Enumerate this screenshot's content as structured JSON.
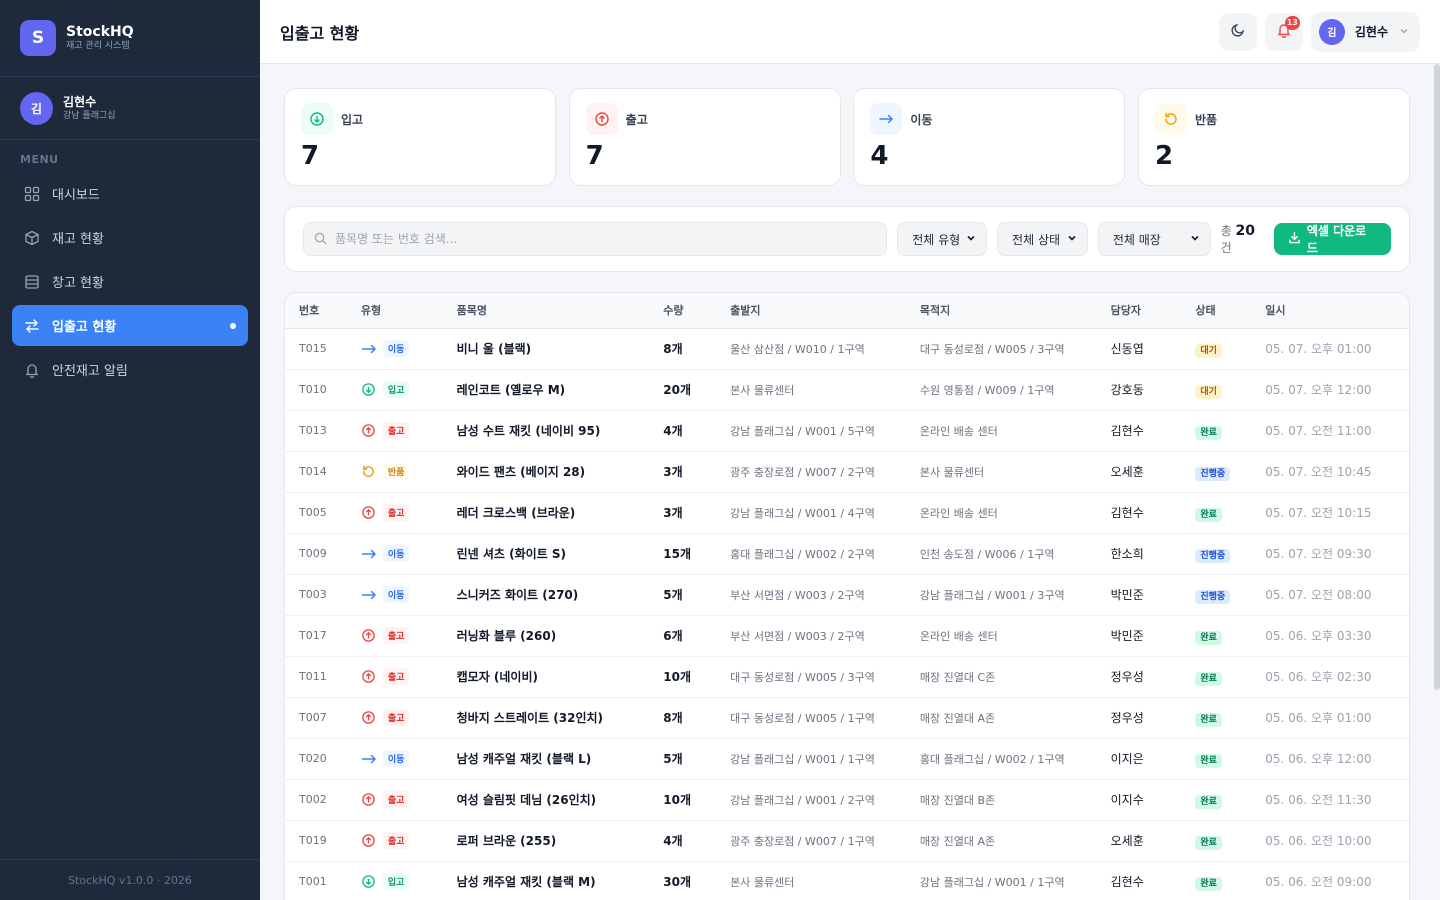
{
  "app": {
    "brand": "StockHQ",
    "brand_subtitle": "재고 관리 시스템",
    "logo_letter": "S",
    "footer": "StockHQ v1.0.0 · 2026"
  },
  "user": {
    "avatar_letter": "김",
    "name": "김현수",
    "store": "강남 플래그십"
  },
  "sidebar": {
    "menu_label": "MENU",
    "items": [
      {
        "label": "대시보드",
        "icon": "dashboard-icon"
      },
      {
        "label": "재고 현황",
        "icon": "box-icon"
      },
      {
        "label": "창고 현황",
        "icon": "warehouse-icon"
      },
      {
        "label": "입출고 현황",
        "icon": "transfer-icon",
        "active": true
      },
      {
        "label": "안전재고 알림",
        "icon": "bell-icon"
      }
    ]
  },
  "header": {
    "title": "입출고 현황",
    "notification_count": "13",
    "user_name": "김현수"
  },
  "stats": [
    {
      "label": "입고",
      "value": "7",
      "icon": "arrow-down-circle-icon",
      "color": "#10b981",
      "bg": "#ecfdf5"
    },
    {
      "label": "출고",
      "value": "7",
      "icon": "arrow-up-circle-icon",
      "color": "#ef4444",
      "bg": "#fef2f2"
    },
    {
      "label": "이동",
      "value": "4",
      "icon": "arrow-right-icon",
      "color": "#3b82f6",
      "bg": "#eff6ff"
    },
    {
      "label": "반품",
      "value": "2",
      "icon": "rotate-icon",
      "color": "#f59e0b",
      "bg": "#fffbeb"
    }
  ],
  "filters": {
    "search_placeholder": "품목명 또는 번호 검색...",
    "type_select": "전체 유형",
    "status_select": "전체 상태",
    "store_select": "전체 매장",
    "total_prefix": "총",
    "total_count": "20",
    "total_suffix": "건",
    "excel_button": "엑셀 다운로드"
  },
  "table": {
    "columns": [
      "번호",
      "유형",
      "품목명",
      "수량",
      "출발지",
      "목적지",
      "담당자",
      "상태",
      "일시"
    ],
    "rows": [
      {
        "id": "T015",
        "type": "이동",
        "kind": "move",
        "name": "비니 울 (블랙)",
        "qty": "8개",
        "from": "울산 삼산점 / W010 / 1구역",
        "to": "대구 동성로점 / W005 / 3구역",
        "manager": "신동엽",
        "status": "대기",
        "status_kind": "wait",
        "date": "05. 07. 오후 01:00"
      },
      {
        "id": "T010",
        "type": "입고",
        "kind": "in",
        "name": "레인코트 (옐로우 M)",
        "qty": "20개",
        "from": "본사 물류센터",
        "to": "수원 영통점 / W009 / 1구역",
        "manager": "강호동",
        "status": "대기",
        "status_kind": "wait",
        "date": "05. 07. 오후 12:00"
      },
      {
        "id": "T013",
        "type": "출고",
        "kind": "out",
        "name": "남성 수트 재킷 (네이비 95)",
        "qty": "4개",
        "from": "강남 플래그십 / W001 / 5구역",
        "to": "온라인 배송 센터",
        "manager": "김현수",
        "status": "완료",
        "status_kind": "done",
        "date": "05. 07. 오전 11:00"
      },
      {
        "id": "T014",
        "type": "반품",
        "kind": "ret",
        "name": "와이드 팬츠 (베이지 28)",
        "qty": "3개",
        "from": "광주 충장로점 / W007 / 2구역",
        "to": "본사 물류센터",
        "manager": "오세훈",
        "status": "진행중",
        "status_kind": "prog",
        "date": "05. 07. 오전 10:45"
      },
      {
        "id": "T005",
        "type": "출고",
        "kind": "out",
        "name": "레더 크로스백 (브라운)",
        "qty": "3개",
        "from": "강남 플래그십 / W001 / 4구역",
        "to": "온라인 배송 센터",
        "manager": "김현수",
        "status": "완료",
        "status_kind": "done",
        "date": "05. 07. 오전 10:15"
      },
      {
        "id": "T009",
        "type": "이동",
        "kind": "move",
        "name": "린넨 셔츠 (화이트 S)",
        "qty": "15개",
        "from": "홍대 플래그십 / W002 / 2구역",
        "to": "인천 송도점 / W006 / 1구역",
        "manager": "한소희",
        "status": "진행중",
        "status_kind": "prog",
        "date": "05. 07. 오전 09:30"
      },
      {
        "id": "T003",
        "type": "이동",
        "kind": "move",
        "name": "스니커즈 화이트 (270)",
        "qty": "5개",
        "from": "부산 서면점 / W003 / 2구역",
        "to": "강남 플래그십 / W001 / 3구역",
        "manager": "박민준",
        "status": "진행중",
        "status_kind": "prog",
        "date": "05. 07. 오전 08:00"
      },
      {
        "id": "T017",
        "type": "출고",
        "kind": "out",
        "name": "러닝화 블루 (260)",
        "qty": "6개",
        "from": "부산 서면점 / W003 / 2구역",
        "to": "온라인 배송 센터",
        "manager": "박민준",
        "status": "완료",
        "status_kind": "done",
        "date": "05. 06. 오후 03:30"
      },
      {
        "id": "T011",
        "type": "출고",
        "kind": "out",
        "name": "캡모자 (네이비)",
        "qty": "10개",
        "from": "대구 동성로점 / W005 / 3구역",
        "to": "매장 진열대 C존",
        "manager": "정우성",
        "status": "완료",
        "status_kind": "done",
        "date": "05. 06. 오후 02:30"
      },
      {
        "id": "T007",
        "type": "출고",
        "kind": "out",
        "name": "청바지 스트레이트 (32인치)",
        "qty": "8개",
        "from": "대구 동성로점 / W005 / 1구역",
        "to": "매장 진열대 A존",
        "manager": "정우성",
        "status": "완료",
        "status_kind": "done",
        "date": "05. 06. 오후 01:00"
      },
      {
        "id": "T020",
        "type": "이동",
        "kind": "move",
        "name": "남성 캐주얼 재킷 (블랙 L)",
        "qty": "5개",
        "from": "강남 플래그십 / W001 / 1구역",
        "to": "홍대 플래그십 / W002 / 1구역",
        "manager": "이지은",
        "status": "완료",
        "status_kind": "done",
        "date": "05. 06. 오후 12:00"
      },
      {
        "id": "T002",
        "type": "출고",
        "kind": "out",
        "name": "여성 슬림핏 데님 (26인치)",
        "qty": "10개",
        "from": "강남 플래그십 / W001 / 2구역",
        "to": "매장 진열대 B존",
        "manager": "이지수",
        "status": "완료",
        "status_kind": "done",
        "date": "05. 06. 오전 11:30"
      },
      {
        "id": "T019",
        "type": "출고",
        "kind": "out",
        "name": "로퍼 브라운 (255)",
        "qty": "4개",
        "from": "광주 충장로점 / W007 / 1구역",
        "to": "매장 진열대 A존",
        "manager": "오세훈",
        "status": "완료",
        "status_kind": "done",
        "date": "05. 06. 오전 10:00"
      },
      {
        "id": "T001",
        "type": "입고",
        "kind": "in",
        "name": "남성 캐주얼 재킷 (블랙 M)",
        "qty": "30개",
        "from": "본사 물류센터",
        "to": "강남 플래그십 / W001 / 1구역",
        "manager": "김현수",
        "status": "완료",
        "status_kind": "done",
        "date": "05. 06. 오전 09:00"
      }
    ]
  }
}
